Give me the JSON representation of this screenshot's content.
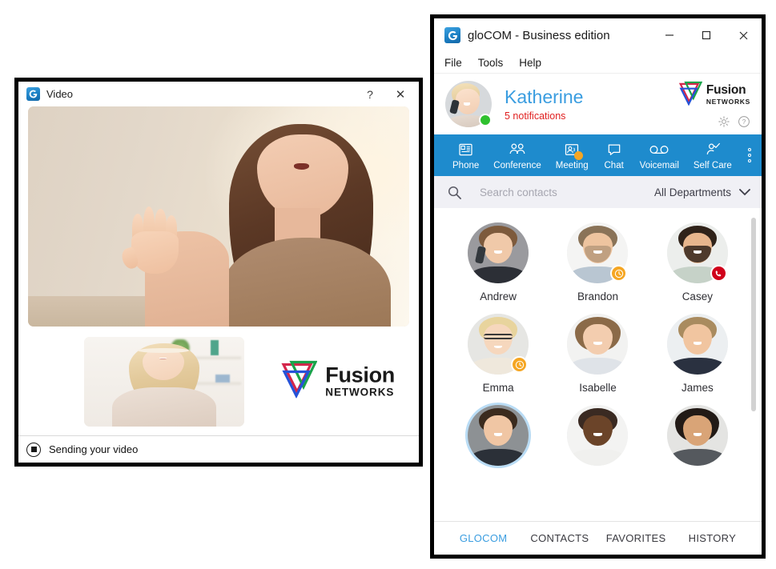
{
  "video_window": {
    "title": "Video",
    "logo_icon": "glocom-logo-icon",
    "help_label": "?",
    "close_label": "✕",
    "brand": {
      "name": "Fusion",
      "sub": "NETWORKS",
      "mark_icon": "fusion-triangle-icon"
    },
    "status": {
      "icon": "stop-recording-icon",
      "text": "Sending your video"
    },
    "remote_video_alt": "remote-video-feed",
    "self_video_alt": "self-video-preview"
  },
  "glocom_window": {
    "title": "gloCOM - Business edition",
    "logo_icon": "glocom-logo-icon",
    "window_controls": {
      "minimize": "minimize-icon",
      "maximize": "maximize-icon",
      "close": "close-icon"
    },
    "menu": [
      "File",
      "Tools",
      "Help"
    ],
    "profile": {
      "name": "Katherine",
      "notifications": "5 notifications",
      "presence_color": "#2fc12f",
      "avatar_alt": "katherine-avatar",
      "brand": {
        "name": "Fusion",
        "sub": "NETWORKS",
        "mark_icon": "fusion-triangle-icon"
      },
      "settings_icon": "gear-icon",
      "help_icon": "help-circle-icon"
    },
    "toolbar": {
      "accent_color": "#1e8bcd",
      "items": [
        {
          "label": "Phone",
          "icon": "desk-phone-icon",
          "badge": false
        },
        {
          "label": "Conference",
          "icon": "group-icon",
          "badge": false
        },
        {
          "label": "Meeting",
          "icon": "meeting-icon",
          "badge": true,
          "badge_color": "#f5a623"
        },
        {
          "label": "Chat",
          "icon": "chat-bubble-icon",
          "badge": false
        },
        {
          "label": "Voicemail",
          "icon": "voicemail-icon",
          "badge": false
        },
        {
          "label": "Self Care",
          "icon": "self-care-icon",
          "badge": false
        }
      ],
      "more_icon": "more-vertical-icon"
    },
    "search": {
      "icon": "search-icon",
      "value": "",
      "placeholder": "Search contacts",
      "department": "All Departments",
      "department_icon": "chevron-down-icon"
    },
    "contacts": [
      {
        "name": "Andrew",
        "status": "available",
        "badge": null,
        "badge_color": null,
        "selected": false
      },
      {
        "name": "Brandon",
        "status": "away",
        "badge": "clock-icon",
        "badge_color": "#f5a623",
        "selected": false
      },
      {
        "name": "Casey",
        "status": "on-call",
        "badge": "phone-icon",
        "badge_color": "#d0021b",
        "selected": false
      },
      {
        "name": "Emma",
        "status": "away",
        "badge": "clock-icon",
        "badge_color": "#f5a623",
        "selected": false
      },
      {
        "name": "Isabelle",
        "status": "available",
        "badge": null,
        "badge_color": null,
        "selected": false
      },
      {
        "name": "James",
        "status": "available",
        "badge": null,
        "badge_color": null,
        "selected": false
      },
      {
        "name": "",
        "status": "available",
        "badge": null,
        "badge_color": null,
        "selected": true
      },
      {
        "name": "",
        "status": "available",
        "badge": null,
        "badge_color": null,
        "selected": false
      },
      {
        "name": "",
        "status": "available",
        "badge": null,
        "badge_color": null,
        "selected": false
      }
    ],
    "tabs": [
      {
        "label": "GLOCOM",
        "active": true
      },
      {
        "label": "CONTACTS",
        "active": false
      },
      {
        "label": "FAVORITES",
        "active": false
      },
      {
        "label": "HISTORY",
        "active": false
      }
    ]
  }
}
